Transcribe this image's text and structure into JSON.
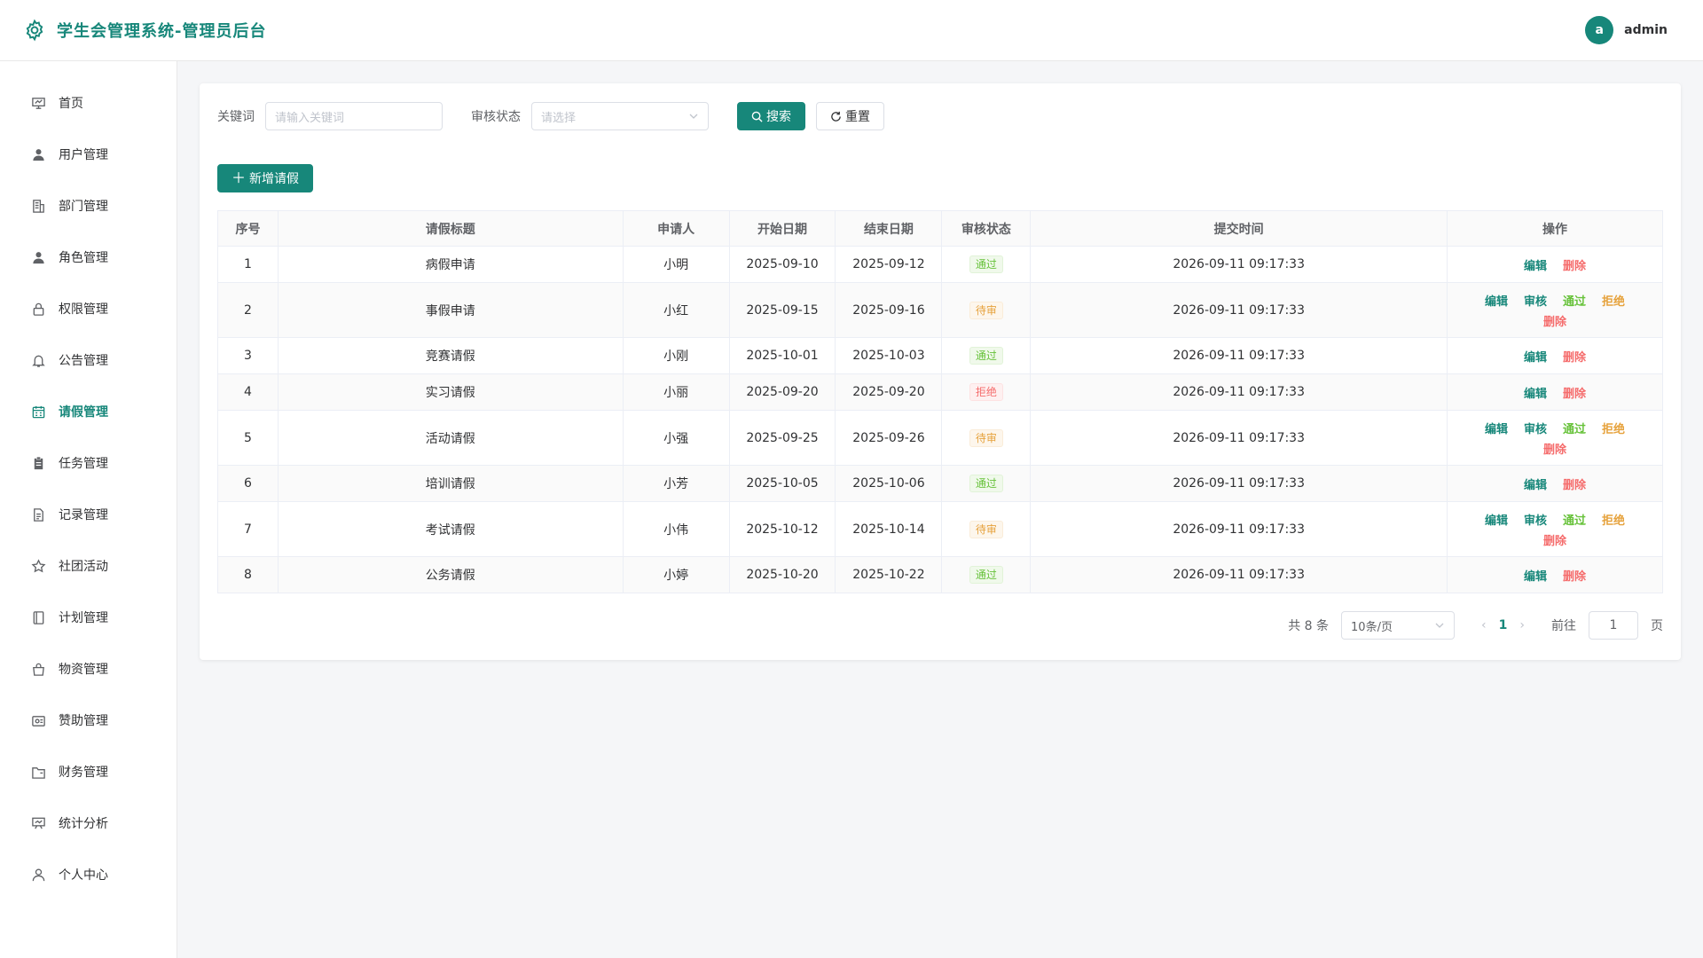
{
  "header": {
    "title": "学生会管理系统-管理员后台",
    "avatar_letter": "a",
    "username": "admin"
  },
  "colors": {
    "accent": "#17877a",
    "pass": "#67c23a",
    "pending": "#e6a23c",
    "reject": "#f56c6c"
  },
  "sidebar": {
    "items": [
      {
        "label": "首页",
        "icon": "dashboard-icon",
        "active": false
      },
      {
        "label": "用户管理",
        "icon": "user-icon",
        "active": false
      },
      {
        "label": "部门管理",
        "icon": "building-icon",
        "active": false
      },
      {
        "label": "角色管理",
        "icon": "user-icon",
        "active": false
      },
      {
        "label": "权限管理",
        "icon": "lock-icon",
        "active": false
      },
      {
        "label": "公告管理",
        "icon": "bell-icon",
        "active": false
      },
      {
        "label": "请假管理",
        "icon": "calendar-icon",
        "active": true
      },
      {
        "label": "任务管理",
        "icon": "clipboard-icon",
        "active": false
      },
      {
        "label": "记录管理",
        "icon": "document-icon",
        "active": false
      },
      {
        "label": "社团活动",
        "icon": "star-icon",
        "active": false
      },
      {
        "label": "计划管理",
        "icon": "notebook-icon",
        "active": false
      },
      {
        "label": "物资管理",
        "icon": "bag-icon",
        "active": false
      },
      {
        "label": "赞助管理",
        "icon": "wallet-icon",
        "active": false
      },
      {
        "label": "财务管理",
        "icon": "folder-icon",
        "active": false
      },
      {
        "label": "统计分析",
        "icon": "presentation-icon",
        "active": false
      },
      {
        "label": "个人中心",
        "icon": "person-icon",
        "active": false
      }
    ]
  },
  "filter": {
    "keyword_label": "关键词",
    "keyword_placeholder": "请输入关键词",
    "status_label": "审核状态",
    "status_placeholder": "请选择",
    "search_label": "搜索",
    "reset_label": "重置"
  },
  "toolbar": {
    "add_label": "新增请假"
  },
  "table": {
    "columns": [
      "序号",
      "请假标题",
      "申请人",
      "开始日期",
      "结束日期",
      "审核状态",
      "提交时间",
      "操作"
    ],
    "rows": [
      {
        "no": "1",
        "title": "病假申请",
        "applicant": "小明",
        "start": "2025-09-10",
        "end": "2025-09-12",
        "status": "通过",
        "status_type": "pass",
        "submitted": "2026-09-11 09:17:33",
        "ops": [
          "编辑",
          "删除"
        ]
      },
      {
        "no": "2",
        "title": "事假申请",
        "applicant": "小红",
        "start": "2025-09-15",
        "end": "2025-09-16",
        "status": "待审",
        "status_type": "pending",
        "submitted": "2026-09-11 09:17:33",
        "ops": [
          "编辑",
          "审核",
          "通过",
          "拒绝",
          "删除"
        ]
      },
      {
        "no": "3",
        "title": "竞赛请假",
        "applicant": "小刚",
        "start": "2025-10-01",
        "end": "2025-10-03",
        "status": "通过",
        "status_type": "pass",
        "submitted": "2026-09-11 09:17:33",
        "ops": [
          "编辑",
          "删除"
        ]
      },
      {
        "no": "4",
        "title": "实习请假",
        "applicant": "小丽",
        "start": "2025-09-20",
        "end": "2025-09-20",
        "status": "拒绝",
        "status_type": "reject",
        "submitted": "2026-09-11 09:17:33",
        "ops": [
          "编辑",
          "删除"
        ]
      },
      {
        "no": "5",
        "title": "活动请假",
        "applicant": "小强",
        "start": "2025-09-25",
        "end": "2025-09-26",
        "status": "待审",
        "status_type": "pending",
        "submitted": "2026-09-11 09:17:33",
        "ops": [
          "编辑",
          "审核",
          "通过",
          "拒绝",
          "删除"
        ]
      },
      {
        "no": "6",
        "title": "培训请假",
        "applicant": "小芳",
        "start": "2025-10-05",
        "end": "2025-10-06",
        "status": "通过",
        "status_type": "pass",
        "submitted": "2026-09-11 09:17:33",
        "ops": [
          "编辑",
          "删除"
        ]
      },
      {
        "no": "7",
        "title": "考试请假",
        "applicant": "小伟",
        "start": "2025-10-12",
        "end": "2025-10-14",
        "status": "待审",
        "status_type": "pending",
        "submitted": "2026-09-11 09:17:33",
        "ops": [
          "编辑",
          "审核",
          "通过",
          "拒绝",
          "删除"
        ]
      },
      {
        "no": "8",
        "title": "公务请假",
        "applicant": "小婷",
        "start": "2025-10-20",
        "end": "2025-10-22",
        "status": "通过",
        "status_type": "pass",
        "submitted": "2026-09-11 09:17:33",
        "ops": [
          "编辑",
          "删除"
        ]
      }
    ]
  },
  "pagination": {
    "total_text": "共 8 条",
    "page_size": "10条/页",
    "current_page": "1",
    "goto_label": "前往",
    "goto_value": "1",
    "page_suffix": "页"
  }
}
